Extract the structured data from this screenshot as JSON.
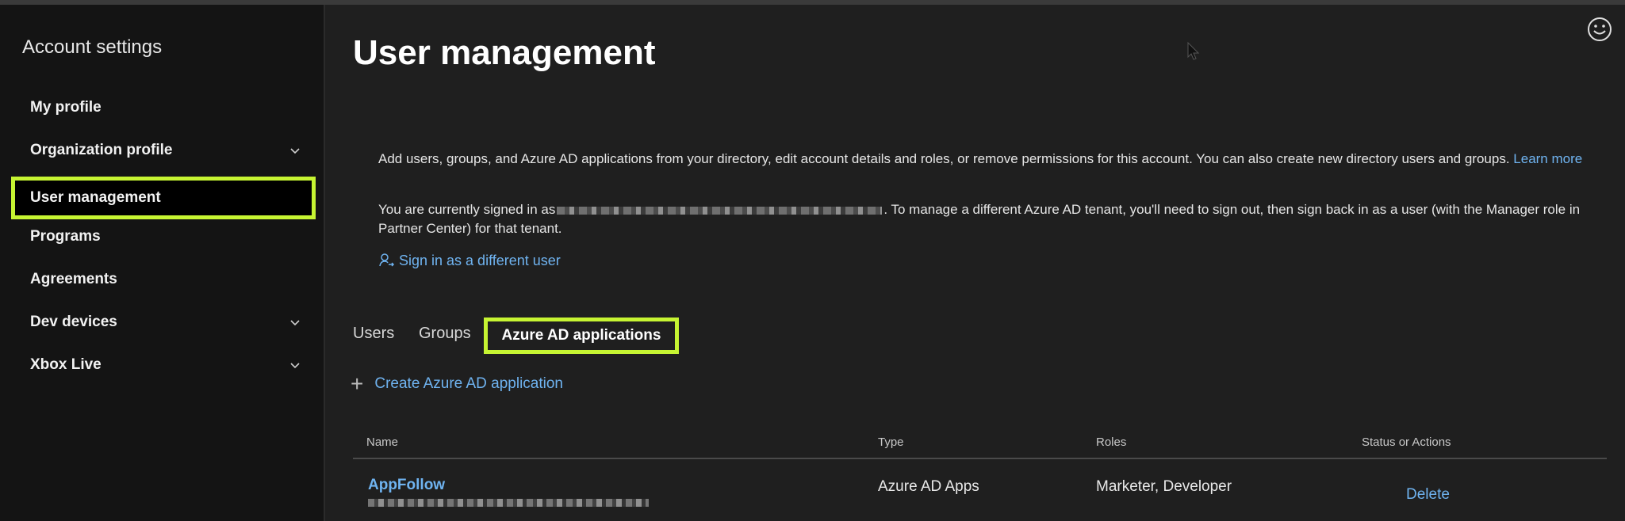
{
  "sidebar": {
    "title": "Account settings",
    "items": [
      {
        "label": "My profile"
      },
      {
        "label": "Organization profile"
      },
      {
        "label": "User management"
      },
      {
        "label": "Programs"
      },
      {
        "label": "Agreements"
      },
      {
        "label": "Dev devices"
      },
      {
        "label": "Xbox Live"
      }
    ]
  },
  "header": {
    "title": "User management"
  },
  "main": {
    "description": "Add users, groups, and Azure AD applications from your directory, edit account details and roles, or remove permissions for this account. You can also create new directory users and groups.",
    "learn_more": "Learn more",
    "signed_in_prefix": "You are currently signed in as",
    "signed_in_suffix": ". To manage a different Azure AD tenant, you'll need to sign out, then sign back in as a user (with the Manager role in Partner Center) for that tenant.",
    "sign_in_link": "Sign in as a different user",
    "tabs": [
      {
        "label": "Users"
      },
      {
        "label": "Groups"
      },
      {
        "label": "Azure AD applications"
      }
    ],
    "create_link": "Create Azure AD application",
    "table": {
      "headers": [
        "Name",
        "Type",
        "Roles",
        "Status or Actions"
      ],
      "rows": [
        {
          "name": "AppFollow",
          "type": "Azure AD Apps",
          "roles": "Marketer, Developer",
          "action": "Delete"
        }
      ]
    }
  },
  "colors": {
    "highlight": "#c6f432",
    "link": "#6fb3f0",
    "background": "#1f1f1f",
    "sidebar": "#141414"
  },
  "icons": [
    "chevron-down-icon",
    "smiley-icon",
    "person-switch-icon",
    "plus-icon",
    "mouse-cursor-icon"
  ]
}
